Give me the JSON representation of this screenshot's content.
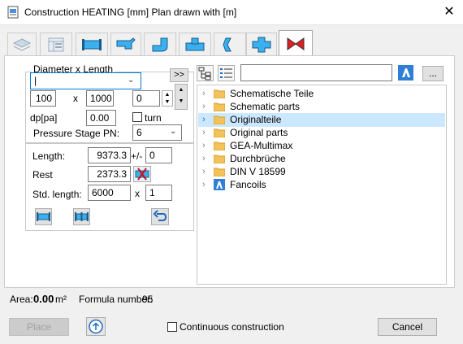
{
  "window": {
    "title": "Construction HEATING [mm]    Plan drawn with  [m]",
    "close_label": "✕"
  },
  "left": {
    "diameter_group_label": "Diameter  x  Length",
    "diameter_value": "|",
    "expand_label": ">>",
    "dim1": "100",
    "x1": "x",
    "dim2": "1000",
    "dim3": "0",
    "dp_label": "dp[pa]",
    "dp_value": "0.00",
    "turn_label": "turn",
    "pressure_label": "Pressure Stage PN:",
    "pressure_value": "6",
    "length_label": "Length:",
    "length_value": "9373.3",
    "plusminus": "+/-",
    "tolerance": "0",
    "rest_label": "Rest",
    "rest_value": "2373.3",
    "std_length_label": "Std. length:",
    "std_length_value": "6000",
    "x2": "x",
    "count": "1"
  },
  "right": {
    "search_value": "",
    "browse_label": "...",
    "tree": [
      {
        "label": "Schematische Teile",
        "icon": "folder-icon"
      },
      {
        "label": "Schematic parts",
        "icon": "folder-icon"
      },
      {
        "label": "Originalteile",
        "icon": "folder-icon",
        "selected": true
      },
      {
        "label": "Original parts",
        "icon": "folder-icon"
      },
      {
        "label": "GEA-Multimax",
        "icon": "folder-icon"
      },
      {
        "label": "Durchbrüche",
        "icon": "folder-icon"
      },
      {
        "label": "DIN V 18599",
        "icon": "folder-icon"
      },
      {
        "label": "Fancoils",
        "icon": "fancoil-icon"
      }
    ]
  },
  "status": {
    "area_label": "Area:",
    "area_value": "0.00",
    "area_unit": "m²",
    "formula_label": "Formula number:",
    "formula_value": "95"
  },
  "footer": {
    "place_label": "Place",
    "continuous_label": "Continuous construction",
    "cancel_label": "Cancel"
  }
}
